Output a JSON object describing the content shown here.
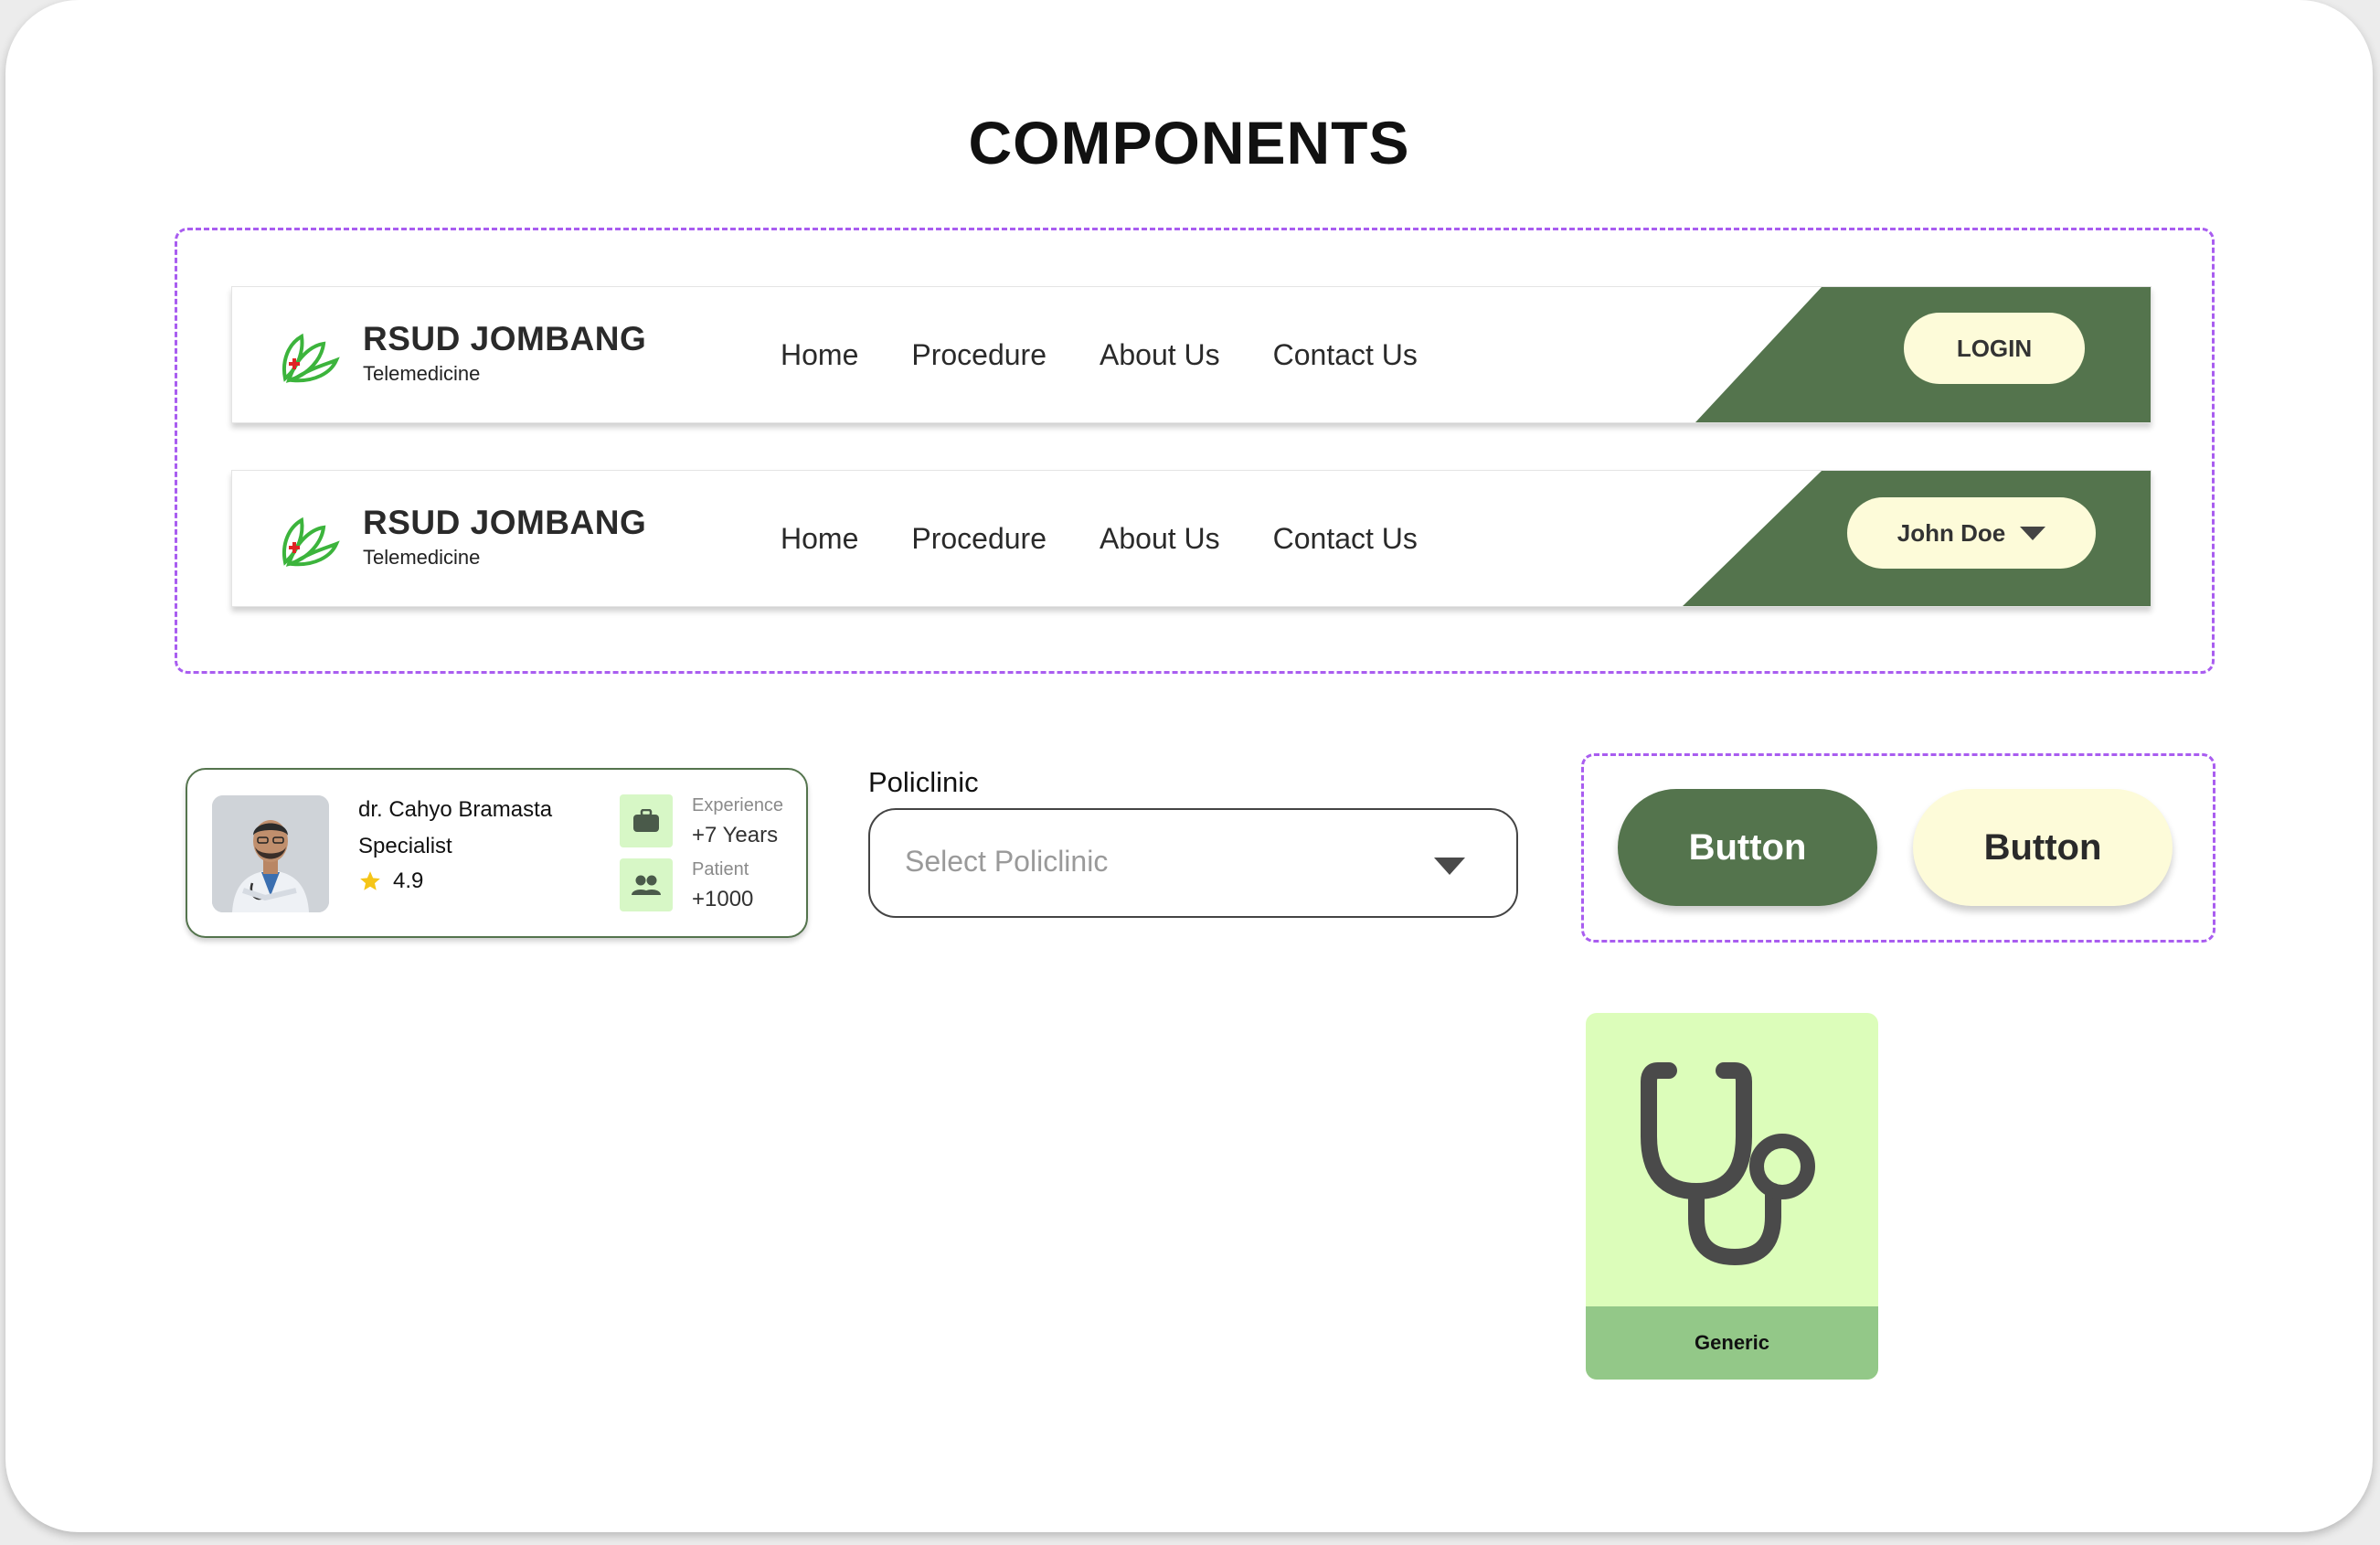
{
  "page": {
    "title": "COMPONENTS"
  },
  "brand": {
    "name": "RSUD JOMBANG",
    "subtitle": "Telemedicine"
  },
  "nav": {
    "links": [
      "Home",
      "Procedure",
      "About Us",
      "Contact Us"
    ]
  },
  "navbar_guest": {
    "login_label": "LOGIN"
  },
  "navbar_user": {
    "user_name": "John Doe"
  },
  "doctor_card": {
    "name": "dr. Cahyo Bramasta",
    "specialty": "Specialist",
    "rating": "4.9",
    "experience_label": "Experience",
    "experience_value": "+7 Years",
    "patient_label": "Patient",
    "patient_value": "+1000"
  },
  "policlinic": {
    "label": "Policlinic",
    "placeholder": "Select Policlinic"
  },
  "buttons": {
    "primary_label": "Button",
    "secondary_label": "Button"
  },
  "category_card": {
    "label": "Generic",
    "icon": "stethoscope-icon"
  },
  "colors": {
    "brand_green": "#54744d",
    "cream": "#fdfbd9",
    "light_green": "#dcfdba",
    "mid_green": "#93c888",
    "dashed_border": "#a95df0",
    "star": "#f5c518"
  }
}
